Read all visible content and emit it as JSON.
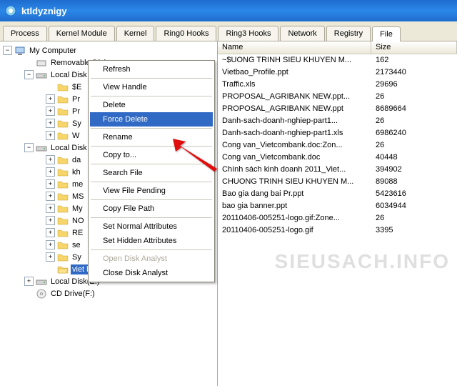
{
  "window": {
    "title": "ktldyznigy"
  },
  "tabs": [
    "Process",
    "Kernel Module",
    "Kernel",
    "Ring0 Hooks",
    "Ring3 Hooks",
    "Network",
    "Registry",
    "File"
  ],
  "tree": {
    "root": "My Computer",
    "items": [
      "Removable Disk",
      "Local Disk",
      "$E",
      "Pr",
      "Pr",
      "Sy",
      "W",
      "Local Disk",
      "da",
      "kh",
      "me",
      "MS",
      "My",
      "NO",
      "RE",
      "se",
      "Sy",
      "viet bao",
      "Local Disk(E:)",
      "CD Drive(F:)"
    ]
  },
  "context_menu": {
    "items": [
      "Refresh",
      "View Handle",
      "Delete",
      "Force Delete",
      "Rename",
      "Copy to...",
      "Search File",
      "View File Pending",
      "Copy File Path",
      "Set Normal Attributes",
      "Set Hidden Attributes",
      "Open Disk Analyst",
      "Close Disk Analyst"
    ],
    "highlighted": "Force Delete",
    "disabled": "Open Disk Analyst"
  },
  "filelist": {
    "columns": {
      "name": "Name",
      "size": "Size"
    },
    "rows": [
      {
        "name": "~$UONG TRINH SIEU KHUYEN M...",
        "size": "162"
      },
      {
        "name": "Vietbao_Profile.ppt",
        "size": "2173440"
      },
      {
        "name": "Traffic.xls",
        "size": "29696"
      },
      {
        "name": "PROPOSAL_AGRIBANK NEW.ppt...",
        "size": "26"
      },
      {
        "name": "PROPOSAL_AGRIBANK NEW.ppt",
        "size": "8689664"
      },
      {
        "name": "Danh-sach-doanh-nghiep-part1...",
        "size": "26"
      },
      {
        "name": "Danh-sach-doanh-nghiep-part1.xls",
        "size": "6986240"
      },
      {
        "name": "Cong van_Vietcombank.doc:Zon...",
        "size": "26"
      },
      {
        "name": "Cong van_Vietcombank.doc",
        "size": "40448"
      },
      {
        "name": "Chính sách kinh doanh 2011_Viet...",
        "size": "394902"
      },
      {
        "name": "CHUONG TRINH SIEU KHUYEN M...",
        "size": "89088"
      },
      {
        "name": "Bao gia dang bai Pr.ppt",
        "size": "5423616"
      },
      {
        "name": "bao gia banner.ppt",
        "size": "6034944"
      },
      {
        "name": "20110406-005251-logo.gif:Zone...",
        "size": "26"
      },
      {
        "name": "20110406-005251-logo.gif",
        "size": "3395"
      }
    ]
  },
  "watermark": "SIEUSACH.INFO"
}
